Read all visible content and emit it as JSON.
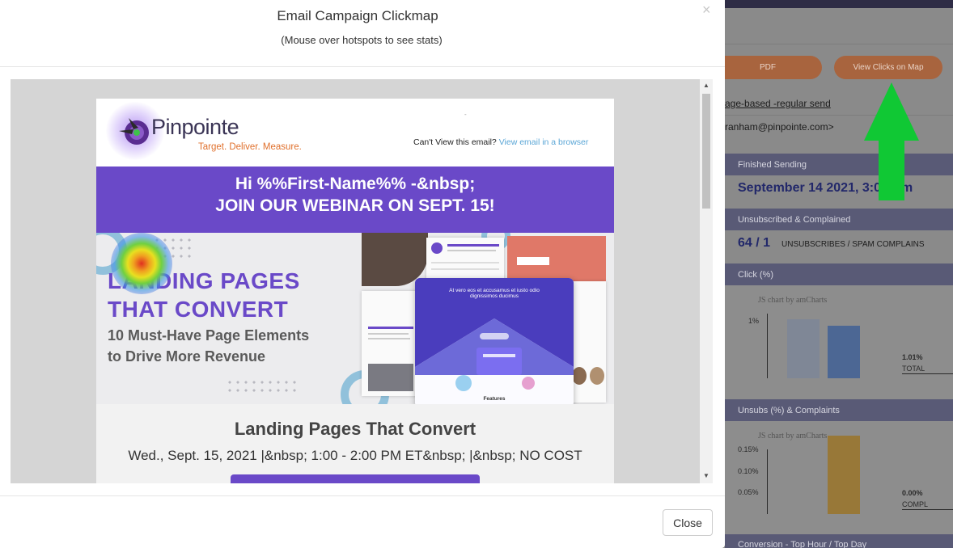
{
  "modal": {
    "title": "Email Campaign Clickmap",
    "subtitle": "(Mouse over hotspots to see stats)",
    "close_x": "×",
    "close_button": "Close"
  },
  "email": {
    "logo_name": "Pinpointe",
    "logo_tagline": "Target. Deliver. Measure.",
    "cant_view_text": "Can't View this email?",
    "view_browser_link": "View email in a browser",
    "banner_line1": "Hi %%First-Name%% -&nbsp;",
    "banner_line2": "JOIN OUR WEBINAR ON SEPT. 15!",
    "hero_title_line1": "LANDING PAGES",
    "hero_title_line2": "THAT CONVERT",
    "hero_sub_line1": "10 Must-Have Page Elements",
    "hero_sub_line2": "to Drive More Revenue",
    "hero_mock_headline": "At vero eos et accusamus et iusto odio dignissimos ducimus",
    "hero_mock_features": "Features",
    "event_title": "Landing Pages That Convert",
    "event_when": "Wed., Sept. 15, 2021 |&nbsp; 1:00 - 2:00 PM ET&nbsp; |&nbsp; NO COST"
  },
  "scrollbar": {
    "up": "▲",
    "down": "▼"
  },
  "background_report": {
    "pdf_button": "PDF",
    "view_clicks_button": "View Clicks on Map",
    "campaign_type_link": "age-based -regular send",
    "from_email": "ranham@pinpointe.com>",
    "finished_sending_header": "Finished Sending",
    "finished_sending_value": "September 14 2021, 3:0",
    "finished_sending_value_tail": "m",
    "unsub_header": "Unsubscribed & Complained",
    "unsub_value": "64 / 1",
    "unsub_label": "UNSUBSCRIBES / SPAM COMPLAINS",
    "click_header": "Click (%)",
    "click_chart_credit": "JS chart by amCharts",
    "click_axis_tick": "1%",
    "click_total_value": "1.01%",
    "click_total_label": "TOTAL",
    "unsubs_header": "Unsubs (%) & Complaints",
    "unsubs_chart_credit": "JS chart by amCharts",
    "unsubs_axis_ticks": [
      "0.15%",
      "0.10%",
      "0.05%"
    ],
    "unsubs_compl_value": "0.00%",
    "unsubs_compl_label": "COMPL",
    "conversion_header": "Conversion - Top Hour / Top Day"
  },
  "colors": {
    "brand_purple": "#6a49c8",
    "tagline_orange": "#e0702c",
    "link_blue": "#5aa6d6",
    "arrow_green": "#10c834",
    "report_button": "#a8643e"
  }
}
